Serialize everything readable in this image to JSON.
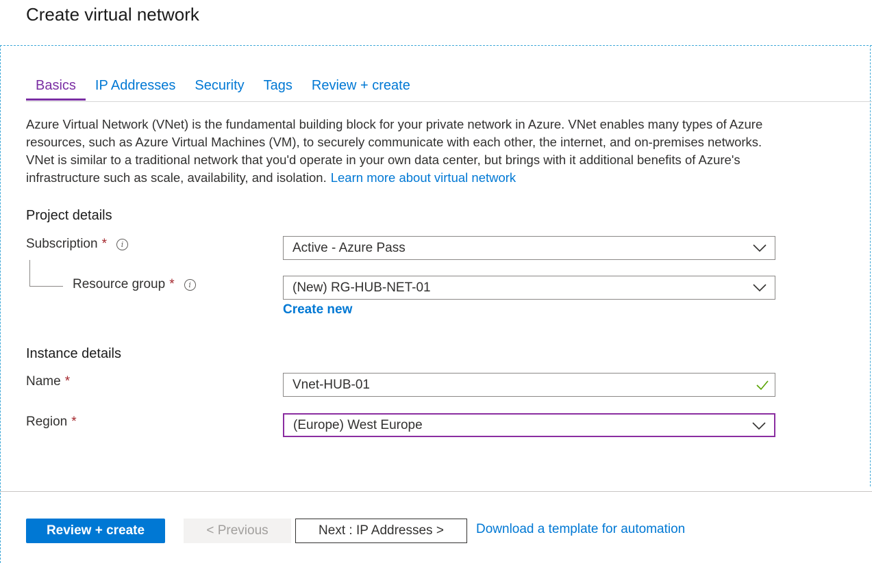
{
  "page": {
    "title": "Create virtual network"
  },
  "tabs": [
    {
      "label": "Basics",
      "active": true
    },
    {
      "label": "IP Addresses",
      "active": false
    },
    {
      "label": "Security",
      "active": false
    },
    {
      "label": "Tags",
      "active": false
    },
    {
      "label": "Review + create",
      "active": false
    }
  ],
  "intro": {
    "text": "Azure Virtual Network (VNet) is the fundamental building block for your private network in Azure. VNet enables many types of Azure resources, such as Azure Virtual Machines (VM), to securely communicate with each other, the internet, and on-premises networks. VNet is similar to a traditional network that you'd operate in your own data center, but brings with it additional benefits of Azure's infrastructure such as scale, availability, and isolation.",
    "link": "Learn more about virtual network"
  },
  "project": {
    "title": "Project details",
    "subscription": {
      "label": "Subscription",
      "required": "*",
      "value": "Active - Azure Pass"
    },
    "resource_group": {
      "label": "Resource group",
      "required": "*",
      "value": "(New) RG-HUB-NET-01",
      "create_new": "Create new"
    }
  },
  "instance": {
    "title": "Instance details",
    "name": {
      "label": "Name",
      "required": "*",
      "value": "Vnet-HUB-01"
    },
    "region": {
      "label": "Region",
      "required": "*",
      "value": "(Europe) West Europe"
    }
  },
  "footer": {
    "review_create": "Review + create",
    "previous": "< Previous",
    "next": "Next : IP Addresses >",
    "download": "Download a template for automation"
  },
  "colors": {
    "accent": "#0078d4",
    "active_tab": "#7a2ea3",
    "required": "#a4262c",
    "valid": "#57a300"
  },
  "icons": {
    "info": "info-icon",
    "chevron": "chevron-down-icon",
    "check": "checkmark-icon"
  }
}
